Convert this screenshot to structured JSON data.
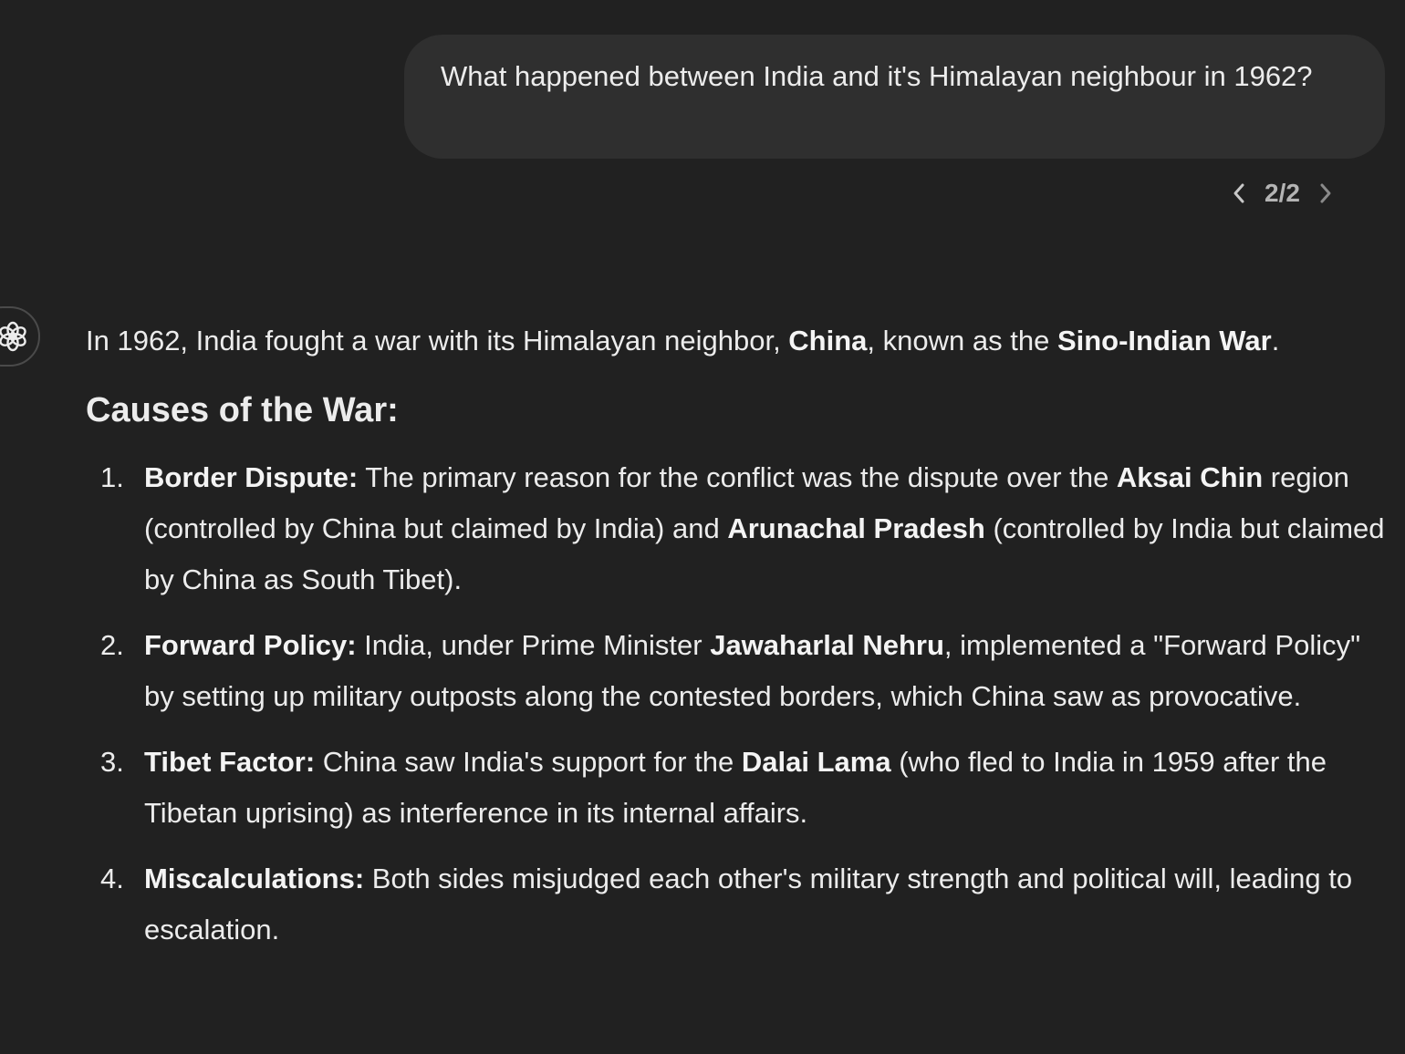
{
  "user_message": {
    "text": "What happened between India and it's Himalayan neighbour in 1962?"
  },
  "pager": {
    "label": "2/2",
    "prev_icon": "chevron-left-icon",
    "next_icon": "chevron-right-icon"
  },
  "assistant": {
    "avatar_icon": "openai-logo-icon",
    "intro": {
      "part1": "In 1962, India fought a war with its Himalayan neighbor, ",
      "bold1": "China",
      "part2": ", known as the ",
      "bold2": "Sino-Indian War",
      "part3": "."
    },
    "heading": "Causes of the War:",
    "items": [
      {
        "number": "1.",
        "title": "Border Dispute:",
        "t1": " The primary reason for the conflict was the dispute over the ",
        "b1": "Aksai Chin",
        "t2": " region (controlled by China but claimed by India) and ",
        "b2": "Arunachal Pradesh",
        "t3": " (controlled by India but claimed by China as South Tibet)."
      },
      {
        "number": "2.",
        "title": "Forward Policy:",
        "t1": " India, under Prime Minister ",
        "b1": "Jawaharlal Nehru",
        "t2": ", implemented a \"Forward Policy\" by setting up military outposts along the contested borders, which China saw as provocative."
      },
      {
        "number": "3.",
        "title": "Tibet Factor:",
        "t1": " China saw India's support for the ",
        "b1": "Dalai Lama",
        "t2": " (who fled to India in 1959 after the Tibetan uprising) as interference in its internal affairs."
      },
      {
        "number": "4.",
        "title": "Miscalculations:",
        "t1": " Both sides misjudged each other's military strength and political will, leading to escalation."
      }
    ]
  }
}
